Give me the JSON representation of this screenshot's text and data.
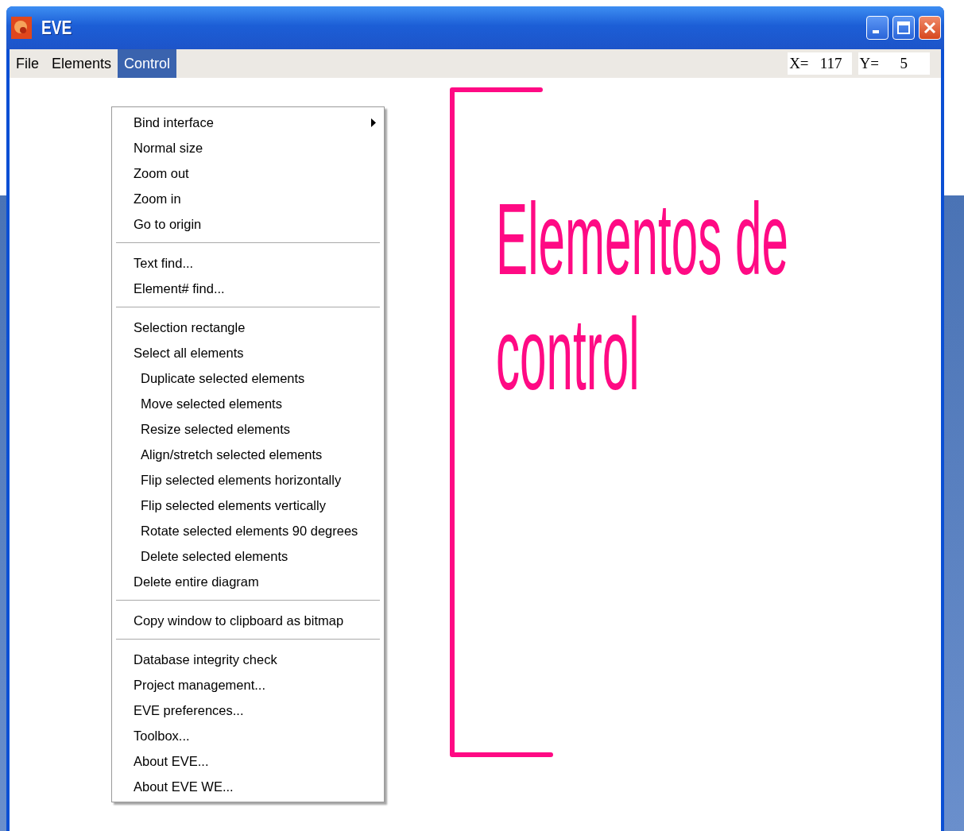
{
  "window": {
    "title": "EVE"
  },
  "menubar": [
    {
      "label": "File",
      "selected": false
    },
    {
      "label": "Elements",
      "selected": false
    },
    {
      "label": "Control",
      "selected": true
    }
  ],
  "coordinates": {
    "x_label": "X=",
    "x_value": "117",
    "y_label": "Y=",
    "y_value": "5"
  },
  "menu": {
    "groups": [
      [
        {
          "label": "Bind interface",
          "kind": "item",
          "submenu": true
        },
        {
          "label": "Normal size",
          "kind": "item",
          "submenu": false
        },
        {
          "label": "Zoom out",
          "kind": "item",
          "submenu": false
        },
        {
          "label": "Zoom in",
          "kind": "item",
          "submenu": false
        },
        {
          "label": "Go to origin",
          "kind": "item",
          "submenu": false
        }
      ],
      [
        {
          "label": "Text find...",
          "kind": "item",
          "submenu": false
        },
        {
          "label": "Element# find...",
          "kind": "item",
          "submenu": false
        }
      ],
      [
        {
          "label": "Selection rectangle",
          "kind": "item",
          "submenu": false
        },
        {
          "label": "Select all elements",
          "kind": "item",
          "submenu": false
        },
        {
          "label": "Duplicate selected elements",
          "kind": "indented",
          "submenu": false
        },
        {
          "label": "Move selected elements",
          "kind": "indented",
          "submenu": false
        },
        {
          "label": "Resize selected elements",
          "kind": "indented",
          "submenu": false
        },
        {
          "label": "Align/stretch selected elements",
          "kind": "indented",
          "submenu": false
        },
        {
          "label": "Flip selected elements horizontally",
          "kind": "indented",
          "submenu": false
        },
        {
          "label": "Flip selected elements vertically",
          "kind": "indented",
          "submenu": false
        },
        {
          "label": "Rotate selected elements 90 degrees",
          "kind": "indented",
          "submenu": false
        },
        {
          "label": "Delete selected elements",
          "kind": "indented",
          "submenu": false
        },
        {
          "label": "Delete entire diagram",
          "kind": "item",
          "submenu": false
        }
      ],
      [
        {
          "label": "Copy window to clipboard as bitmap",
          "kind": "item",
          "submenu": false
        }
      ],
      [
        {
          "label": "Database integrity check",
          "kind": "item",
          "submenu": false
        },
        {
          "label": "Project management...",
          "kind": "item",
          "submenu": false
        },
        {
          "label": "EVE preferences...",
          "kind": "item",
          "submenu": false
        },
        {
          "label": "Toolbox...",
          "kind": "item",
          "submenu": false
        },
        {
          "label": "About EVE...",
          "kind": "item",
          "submenu": false
        },
        {
          "label": "About EVE WE...",
          "kind": "item",
          "submenu": false
        }
      ]
    ]
  },
  "annotation": {
    "text": "Elementos de control",
    "color": "#ff0a84"
  }
}
